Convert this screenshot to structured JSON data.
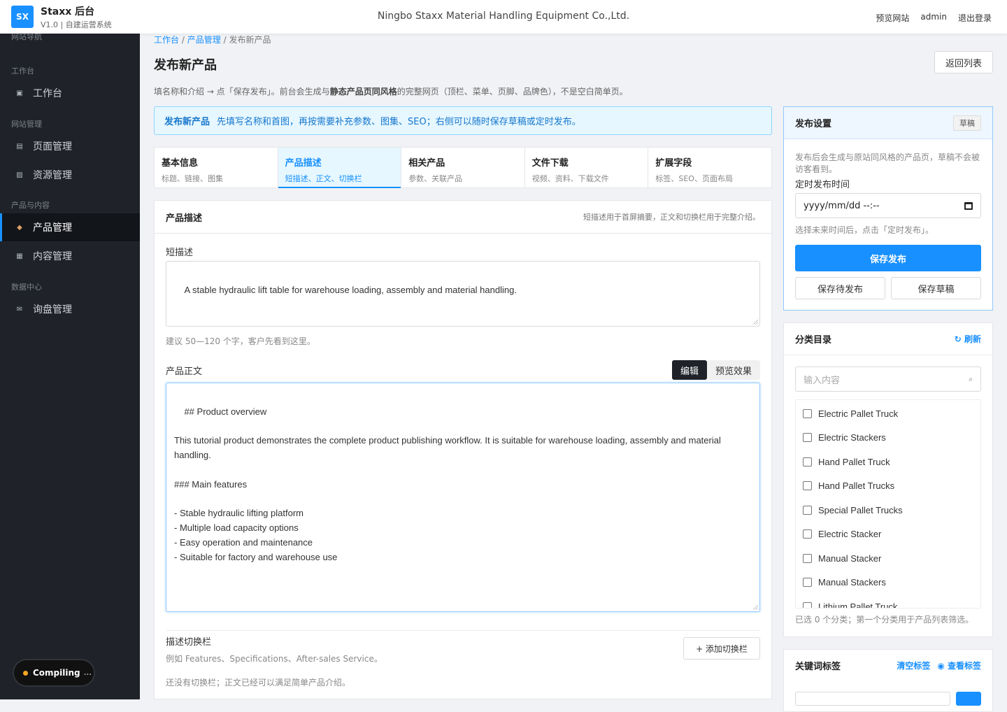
{
  "header": {
    "logo_text": "SX",
    "app_name": "Staxx 后台",
    "version": "V1.0 | 自建运营系统",
    "company": "Ningbo Staxx Material Handling Equipment Co.,Ltd.",
    "links": [
      "预览网站",
      "admin",
      "退出登录"
    ]
  },
  "sidebar": {
    "cut_label": "网站导航",
    "groups": [
      "工作台",
      "网站管理",
      "产品与内容",
      "数据中心"
    ],
    "items": [
      {
        "label": "工作台",
        "icon": "dashboard-icon"
      },
      {
        "label": "页面管理",
        "icon": "page-icon"
      },
      {
        "label": "资源管理",
        "icon": "image-icon"
      },
      {
        "label": "产品管理",
        "icon": "box-icon"
      },
      {
        "label": "内容管理",
        "icon": "article-icon"
      },
      {
        "label": "询盘管理",
        "icon": "mail-icon"
      }
    ],
    "active_index": 3
  },
  "compiling": {
    "label": "Compiling",
    "dots": "..."
  },
  "breadcrumb": {
    "items": [
      "工作台",
      "产品管理",
      "发布新产品"
    ],
    "sep": "/"
  },
  "page": {
    "title": "发布新产品",
    "back_button": "返回列表",
    "desc_pre": "填名称和介绍 → 点「保存发布」。前台会生成与",
    "desc_bold": "静态产品页同风格",
    "desc_post": "的完整网页（顶栏、菜单、页脚、品牌色），不是空白简单页。"
  },
  "notice": {
    "title": "发布新产品",
    "text": "先填写名称和首图，再按需要补充参数、图集、SEO；右侧可以随时保存草稿或定时发布。"
  },
  "tabs": [
    {
      "title": "基本信息",
      "sub": "标题、链接、图集"
    },
    {
      "title": "产品描述",
      "sub": "短描述、正文、切换栏"
    },
    {
      "title": "相关产品",
      "sub": "参数、关联产品"
    },
    {
      "title": "文件下载",
      "sub": "视频、资料、下载文件"
    },
    {
      "title": "扩展字段",
      "sub": "标签、SEO、页面布局"
    }
  ],
  "active_tab": 1,
  "description_panel": {
    "title": "产品描述",
    "note": "短描述用于首屏摘要，正文和切换栏用于完整介绍。",
    "short_label": "短描述",
    "short_value": "A stable hydraulic lift table for warehouse loading, assembly and material handling.",
    "short_hint": "建议 50—120 个字，客户先看到这里。",
    "body_label": "产品正文",
    "mode_edit": "编辑",
    "mode_preview": "预览效果",
    "body_value": "## Product overview\n\nThis tutorial product demonstrates the complete product publishing workflow. It is suitable for warehouse loading, assembly and material handling.\n\n### Main features\n\n- Stable hydraulic lifting platform\n- Multiple load capacity options\n- Easy operation and maintenance\n- Suitable for factory and warehouse use",
    "tabs_label": "描述切换栏",
    "tabs_hint": "例如 Features、Specifications、After-sales Service。",
    "add_tab_button": "+ 添加切换栏",
    "empty_note": "还没有切换栏；正文已经可以满足简单产品介绍。"
  },
  "publish": {
    "title": "发布设置",
    "status_badge": "草稿",
    "desc": "发布后会生成与原站同风格的产品页，草稿不会被访客看到。",
    "time_label": "定时发布时间",
    "time_placeholder": "yyyy/mm/dd --:--",
    "time_hint": "选择未来时间后，点击「定时发布」。",
    "primary_button": "保存发布",
    "pending_button": "保存待发布",
    "draft_button": "保存草稿"
  },
  "categories": {
    "title": "分类目录",
    "refresh": "↻ 刷新",
    "search_placeholder": "输入内容",
    "items": [
      "Electric Pallet Truck",
      "Electric Stackers",
      "Hand Pallet Truck",
      "Hand Pallet Trucks",
      "Special Pallet Trucks",
      "Electric Stacker",
      "Manual Stacker",
      "Manual Stackers",
      "Lithium Pallet Truck"
    ],
    "note": "已选 0 个分类；第一个分类用于产品列表筛选。"
  },
  "keywords": {
    "title": "关键词标签",
    "clear": "清空标签",
    "view": "◉ 查看标签"
  },
  "colors": {
    "accent": "#1890ff",
    "sidebar_bg": "#1f2329"
  }
}
